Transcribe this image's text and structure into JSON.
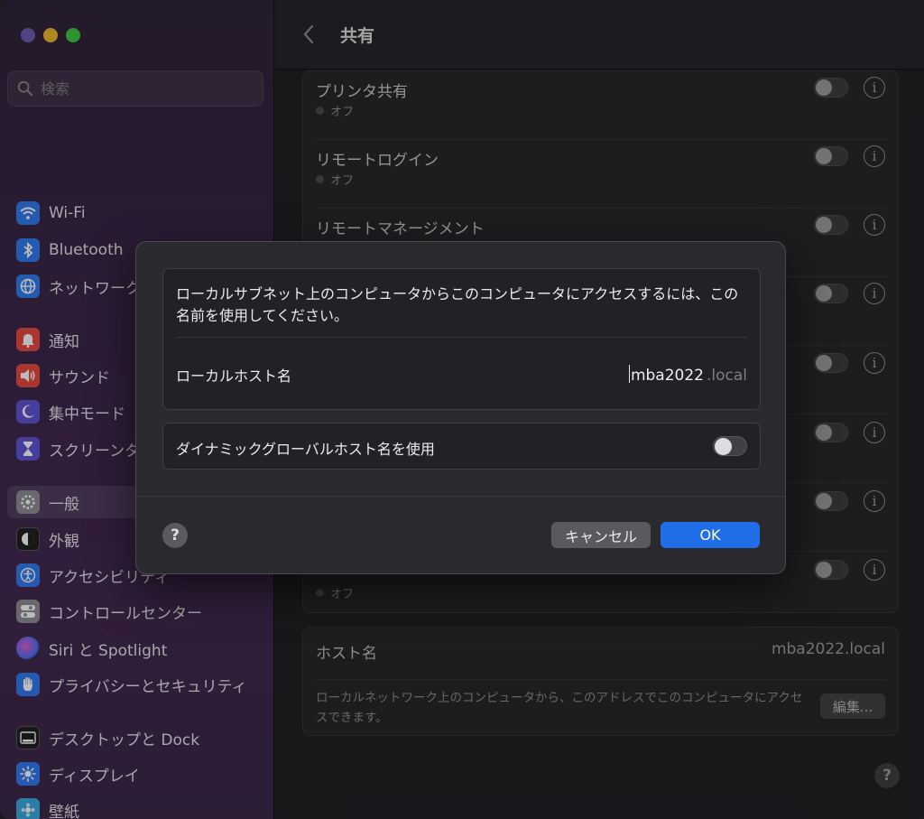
{
  "window": {
    "search": {
      "placeholder": "検索"
    },
    "sidebar": {
      "items": [
        {
          "label": "Wi-Fi",
          "icon": "wifi-icon",
          "color": "#2f7bf0"
        },
        {
          "label": "Bluetooth",
          "icon": "bluetooth-icon",
          "color": "#2f7bf0"
        },
        {
          "label": "ネットワーク",
          "icon": "network-globe-icon",
          "color": "#2f7bf0"
        },
        {
          "label": "通知",
          "icon": "bell-icon",
          "color": "#e8473f"
        },
        {
          "label": "サウンド",
          "icon": "speaker-icon",
          "color": "#e8473f"
        },
        {
          "label": "集中モード",
          "icon": "moon-icon",
          "color": "#5d52d6"
        },
        {
          "label": "スクリーンタイム",
          "icon": "hourglass-icon",
          "color": "#5d52d6"
        },
        {
          "label": "一般",
          "icon": "gear-icon",
          "color": "#8e8e93"
        },
        {
          "label": "外観",
          "icon": "appearance-icon",
          "color": "#1c1c1e"
        },
        {
          "label": "アクセシビリティ",
          "icon": "accessibility-icon",
          "color": "#2f7bf0"
        },
        {
          "label": "コントロールセンター",
          "icon": "control-center-icon",
          "color": "#8e8e93"
        },
        {
          "label": "Siri と Spotlight",
          "icon": "siri-icon",
          "color": "#b050e0"
        },
        {
          "label": "プライバシーとセキュリティ",
          "icon": "hand-icon",
          "color": "#2f7bf0"
        },
        {
          "label": "デスクトップと Dock",
          "icon": "dock-icon",
          "color": "#1c1c1e"
        },
        {
          "label": "ディスプレイ",
          "icon": "brightness-icon",
          "color": "#2f7bf0"
        },
        {
          "label": "壁紙",
          "icon": "wallpaper-icon",
          "color": "#39a9e0"
        }
      ]
    }
  },
  "main": {
    "title": "共有",
    "services": [
      {
        "name": "プリンタ共有",
        "status": "オフ"
      },
      {
        "name": "リモートログイン",
        "status": "オフ"
      },
      {
        "name": "リモートマネージメント",
        "status": ""
      }
    ],
    "host": {
      "label": "ホスト名",
      "value": "mba2022.local",
      "description": "ローカルネットワーク上のコンピュータから、このアドレスでこのコンピュータにアクセスできます。",
      "edit_label": "編集..."
    },
    "last_status": "オフ"
  },
  "sheet": {
    "description": "ローカルサブネット上のコンピュータからこのコンピュータにアクセスするには、この名前を使用してください。",
    "local_hostname_label": "ローカルホスト名",
    "local_hostname_value": "mba2022",
    "local_hostname_suffix": ".local",
    "dynamic_label": "ダイナミックグローバルホスト名を使用",
    "dynamic_enabled": false,
    "help": "?",
    "cancel_label": "キャンセル",
    "ok_label": "OK"
  }
}
